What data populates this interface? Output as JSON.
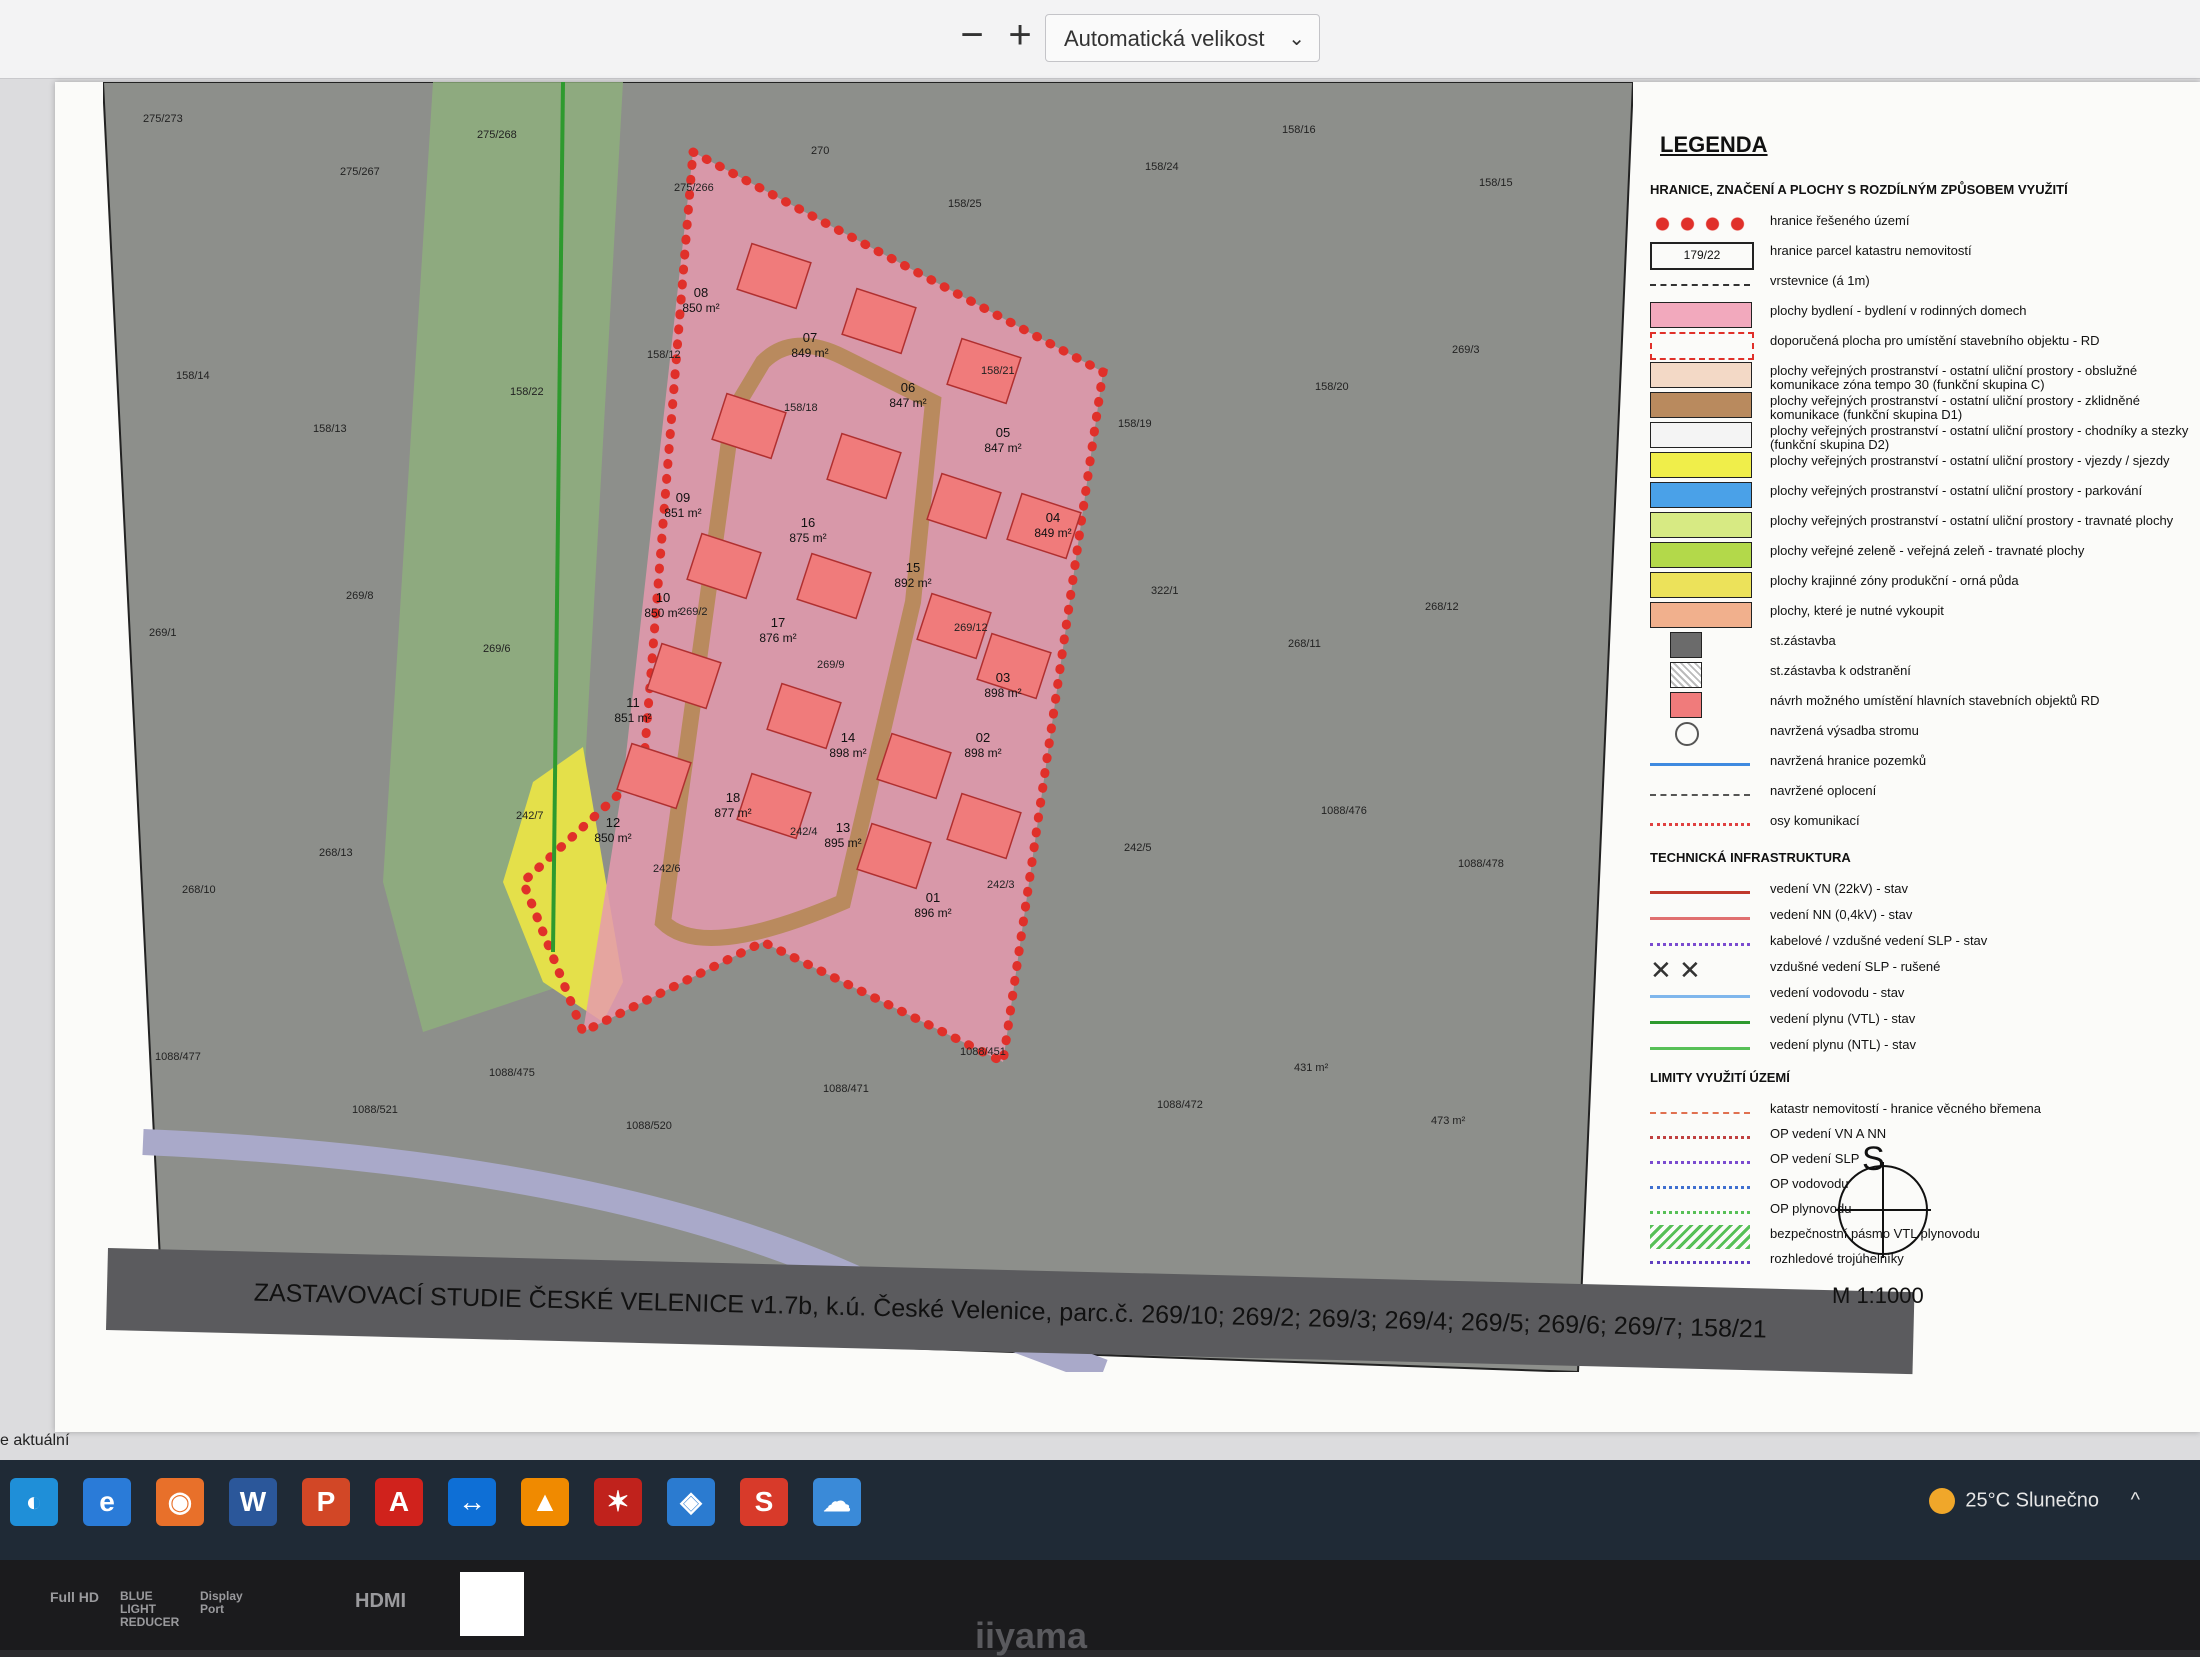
{
  "viewer": {
    "zoom_out": "−",
    "zoom_in": "+",
    "zoom_label": "Automatická velikost",
    "status_left": "e aktuální"
  },
  "map": {
    "title": "ZASTAVOVACÍ STUDIE ČESKÉ VELENICE v1.7b, k.ú. České Velenice, parc.č. 269/10; 269/2; 269/3; 269/4; 269/5; 269/6; 269/7; 158/21",
    "parcels": [
      {
        "num": "08",
        "area": "850 m²"
      },
      {
        "num": "07",
        "area": "849 m²"
      },
      {
        "num": "06",
        "area": "847 m²"
      },
      {
        "num": "05",
        "area": "847 m²"
      },
      {
        "num": "04",
        "area": "849 m²"
      },
      {
        "num": "09",
        "area": "851 m²"
      },
      {
        "num": "16",
        "area": "875 m²"
      },
      {
        "num": "15",
        "area": "892 m²"
      },
      {
        "num": "10",
        "area": "850 m²"
      },
      {
        "num": "17",
        "area": "876 m²"
      },
      {
        "num": "03",
        "area": "898 m²"
      },
      {
        "num": "11",
        "area": "851 m²"
      },
      {
        "num": "14",
        "area": "898 m²"
      },
      {
        "num": "02",
        "area": "898 m²"
      },
      {
        "num": "18",
        "area": "877 m²"
      },
      {
        "num": "13",
        "area": "895 m²"
      },
      {
        "num": "12",
        "area": "850 m²"
      },
      {
        "num": "01",
        "area": "896 m²"
      }
    ],
    "cadastral_labels": [
      "275/273",
      "275/267",
      "275/268",
      "275/266",
      "270",
      "158/25",
      "158/24",
      "158/16",
      "158/15",
      "158/14",
      "158/13",
      "158/22",
      "158/12",
      "158/18",
      "158/21",
      "158/19",
      "158/20",
      "269/3",
      "269/1",
      "269/8",
      "269/6",
      "269/2",
      "269/9",
      "269/12",
      "322/1",
      "268/11",
      "268/12",
      "268/10",
      "268/13",
      "242/7",
      "242/6",
      "242/4",
      "242/3",
      "242/5",
      "1088/476",
      "1088/478",
      "1088/477",
      "1088/521",
      "1088/475",
      "1088/520",
      "1088/471",
      "1088/451",
      "1088/472",
      "431 m²",
      "473 m²"
    ]
  },
  "legend": {
    "title": "LEGENDA",
    "heading_1": "HRANICE, ZNAČENÍ A PLOCHY S ROZDÍLNÝM ZPŮSOBEM VYUŽITÍ",
    "items_1": [
      {
        "label": "hranice řešeného území",
        "swatch": "dots",
        "color": "#e0302a"
      },
      {
        "label": "hranice parcel katastru nemovitostí",
        "swatch": "box-text",
        "text": "179/22",
        "color": "#222222"
      },
      {
        "label": "vrstevnice (á 1m)",
        "swatch": "dash",
        "color": "#333333"
      },
      {
        "label": "plochy bydlení - bydlení v rodinných domech",
        "swatch": "fill",
        "color": "#f2a9bd"
      },
      {
        "label": "doporučená plocha pro umístění stavebního objektu - RD",
        "swatch": "dashbox",
        "color": "#e0302a"
      },
      {
        "label": "plochy veřejných prostranství - ostatní uliční prostory - obslužné komunikace zóna tempo 30 (funkční skupina C)",
        "swatch": "fill",
        "color": "#f3d9c6"
      },
      {
        "label": "plochy veřejných prostranství - ostatní uliční prostory - zklidněné komunikace (funkční skupina D1)",
        "swatch": "fill",
        "color": "#b98a5e"
      },
      {
        "label": "plochy veřejných prostranství - ostatní uliční prostory - chodníky a stezky (funkční skupina D2)",
        "swatch": "fill",
        "color": "#f4f4f4"
      },
      {
        "label": "plochy veřejných prostranství - ostatní uliční prostory - vjezdy / sjezdy",
        "swatch": "fill",
        "color": "#f0ee4a"
      },
      {
        "label": "plochy veřejných prostranství - ostatní uliční prostory - parkování",
        "swatch": "fill",
        "color": "#4aa1e8"
      },
      {
        "label": "plochy veřejných prostranství - ostatní uliční prostory - travnaté plochy",
        "swatch": "fill",
        "color": "#d7ea83"
      },
      {
        "label": "plochy veřejné zeleně - veřejná zeleň - travnaté plochy",
        "swatch": "fill",
        "color": "#b3d94a"
      },
      {
        "label": "plochy krajinné zóny produkční - orná půda",
        "swatch": "fill",
        "color": "#ece25a"
      },
      {
        "label": "plochy, které je nutné vykoupit",
        "swatch": "fill",
        "color": "#f1b08d"
      },
      {
        "label": "st.zástavba",
        "swatch": "small",
        "color": "#6b6b6b"
      },
      {
        "label": "st.zástavba k odstranění",
        "swatch": "small-hatch",
        "color": "#bbbbbb"
      },
      {
        "label": "návrh možného umístění hlavních stavebních objektů RD",
        "swatch": "small",
        "color": "#f07b7b"
      },
      {
        "label": "navržená výsadba stromu",
        "swatch": "circle",
        "color": "#555555"
      },
      {
        "label": "navržená hranice pozemků",
        "swatch": "line",
        "color": "#3f8ae0"
      },
      {
        "label": "navržené oplocení",
        "swatch": "dash",
        "color": "#555555"
      },
      {
        "label": "osy komunikací",
        "swatch": "dashdot",
        "color": "#e04040"
      }
    ],
    "heading_2": "TECHNICKÁ INFRASTRUKTURA",
    "items_2": [
      {
        "label": "vedení VN (22kV) - stav",
        "swatch": "line",
        "color": "#c0392b"
      },
      {
        "label": "vedení NN (0,4kV) - stav",
        "swatch": "line",
        "color": "#e07070"
      },
      {
        "label": "kabelové / vzdušné vedení SLP - stav",
        "swatch": "dashdot",
        "color": "#7a4bd0"
      },
      {
        "label": "vzdušné vedení SLP - rušené",
        "swatch": "cross",
        "color": "#333333"
      },
      {
        "label": "vedení vodovodu - stav",
        "swatch": "line",
        "color": "#7fb6ec"
      },
      {
        "label": "vedení plynu (VTL) - stav",
        "swatch": "line",
        "color": "#2e9a2e"
      },
      {
        "label": "vedení plynu (NTL) - stav",
        "swatch": "line",
        "color": "#57c057"
      }
    ],
    "heading_3": "LIMITY VYUŽITÍ ÚZEMÍ",
    "items_3": [
      {
        "label": "katastr nemovitostí - hranice věcného břemena",
        "swatch": "dash",
        "color": "#e07050"
      },
      {
        "label": "OP vedení VN A NN",
        "swatch": "dashdot",
        "color": "#c04040"
      },
      {
        "label": "OP vedení SLP",
        "swatch": "dashdot",
        "color": "#7a4bd0"
      },
      {
        "label": "OP vodovodu",
        "swatch": "dashdot",
        "color": "#3f6fd0"
      },
      {
        "label": "OP plynovodu",
        "swatch": "dashdot",
        "color": "#57c057"
      },
      {
        "label": "bezpečnostní pásmo VTL plynovodu",
        "swatch": "hatch",
        "color": "#57c057"
      },
      {
        "label": "rozhledové trojúhelníky",
        "swatch": "dashdot",
        "color": "#6040c0"
      }
    ],
    "compass_letter": "S",
    "scale": "M 1:1000"
  },
  "taskbar": {
    "apps": [
      {
        "name": "edge-icon",
        "glyph": "◐",
        "color": "#1f8fd8"
      },
      {
        "name": "ie-icon",
        "glyph": "e",
        "color": "#2a7bd8"
      },
      {
        "name": "firefox-icon",
        "glyph": "◉",
        "color": "#e8702a"
      },
      {
        "name": "word-icon",
        "glyph": "W",
        "color": "#2b579a"
      },
      {
        "name": "powerpoint-icon",
        "glyph": "P",
        "color": "#d24726"
      },
      {
        "name": "acrobat-icon",
        "glyph": "A",
        "color": "#d0221c"
      },
      {
        "name": "teamviewer-icon",
        "glyph": "↔",
        "color": "#0e6fd6"
      },
      {
        "name": "vlc-icon",
        "glyph": "▲",
        "color": "#f08a00"
      },
      {
        "name": "app-red-icon",
        "glyph": "✶",
        "color": "#c0221c"
      },
      {
        "name": "app-fire-icon",
        "glyph": "◈",
        "color": "#2b7bd0"
      },
      {
        "name": "app-s-icon",
        "glyph": "S",
        "color": "#d83a2a"
      },
      {
        "name": "app-cloud-icon",
        "glyph": "☁",
        "color": "#3a8ad8"
      }
    ],
    "weather": "25°C  Slunečno",
    "tray_chevron": "^"
  },
  "bezel": {
    "labels": [
      "Full HD",
      "BLUE LIGHT REDUCER",
      "Display Port",
      "HDMI"
    ],
    "brand": "iiyama"
  }
}
